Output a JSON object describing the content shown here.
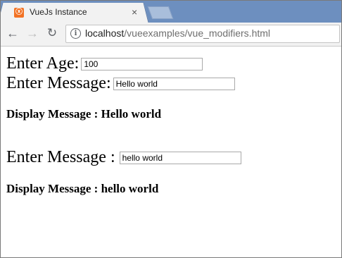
{
  "browser": {
    "tab_title": "VueJs Instance",
    "tab_close": "×",
    "url_host": "localhost",
    "url_path": "/vueexamples/vue_modifiers.html"
  },
  "nav": {
    "back": "←",
    "forward": "→",
    "reload": "↻",
    "info": "i"
  },
  "page": {
    "age_label": "Enter Age:",
    "age_value": "100",
    "message_label": "Enter Message:",
    "message_value": "Hello world",
    "display1": "Display Message : Hello world",
    "message2_label": "Enter Message :",
    "message2_value": "hello world",
    "display2": "Display Message : hello world"
  },
  "colors": {
    "tabstrip": "#6d8fbf",
    "tab_icon": "#f27224"
  }
}
